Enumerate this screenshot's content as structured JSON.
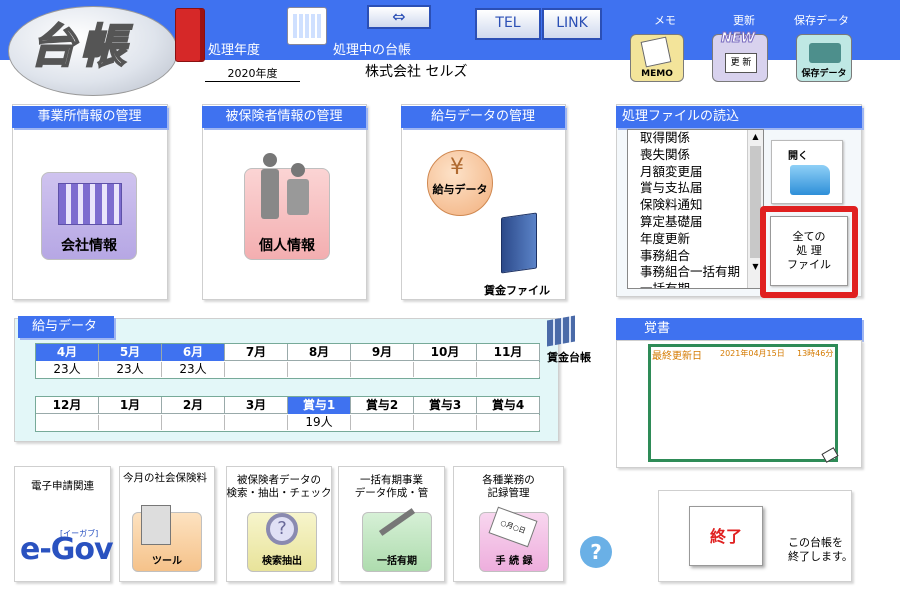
{
  "header": {
    "logo": "台帳",
    "fiscal_year_label": "処理年度",
    "fiscal_year_value": "2020年度",
    "ledger_label": "処理中の台帳",
    "ledger_value": "株式会社 セルズ",
    "tel_label": "TEL",
    "link_label": "LINK",
    "memo_top": "メモ",
    "memo_caption": "MEMO",
    "update_top": "更新",
    "update_new": "NEW",
    "update_caption": "更 新",
    "save_top": "保存データ",
    "save_caption": "保存データ"
  },
  "panels": {
    "office": {
      "title": "事業所情報の管理",
      "caption": "会社情報"
    },
    "insured": {
      "title": "被保険者情報の管理",
      "caption": "個人情報"
    },
    "salary": {
      "title": "給与データの管理",
      "data_caption": "給与データ",
      "file_caption": "賃金ファイル"
    }
  },
  "file_panel": {
    "title": "処理ファイルの読込",
    "items": [
      "取得関係",
      "喪失関係",
      "月額変更届",
      "賞与支払届",
      "保険料通知",
      "算定基礎届",
      "年度更新",
      "事務組合",
      "事務組合一括有期",
      "一括有期"
    ],
    "open_label": "開く",
    "all_files_label": "全ての\n処 理\nファイル"
  },
  "salary_data": {
    "title": "給与データ",
    "ledger_label": "賃金台帳",
    "row1": [
      {
        "month": "4月",
        "count": "23人",
        "active": true
      },
      {
        "month": "5月",
        "count": "23人",
        "active": true
      },
      {
        "month": "6月",
        "count": "23人",
        "active": true
      },
      {
        "month": "7月",
        "count": "",
        "active": false
      },
      {
        "month": "8月",
        "count": "",
        "active": false
      },
      {
        "month": "9月",
        "count": "",
        "active": false
      },
      {
        "month": "10月",
        "count": "",
        "active": false
      },
      {
        "month": "11月",
        "count": "",
        "active": false
      }
    ],
    "row2": [
      {
        "month": "12月",
        "count": "",
        "active": false
      },
      {
        "month": "1月",
        "count": "",
        "active": false
      },
      {
        "month": "2月",
        "count": "",
        "active": false
      },
      {
        "month": "3月",
        "count": "",
        "active": false
      },
      {
        "month": "賞与1",
        "count": "19人",
        "active": true
      },
      {
        "month": "賞与2",
        "count": "",
        "active": false
      },
      {
        "month": "賞与3",
        "count": "",
        "active": false
      },
      {
        "month": "賞与4",
        "count": "",
        "active": false
      }
    ]
  },
  "memo_panel": {
    "title": "覚書",
    "last_updated_label": "最終更新日",
    "last_updated_date": "2021年04月15日",
    "last_updated_time": "13時46分"
  },
  "tools": [
    {
      "label": "電子申請関連",
      "caption": "e-Gov",
      "sub": "[イーガブ]"
    },
    {
      "label": "今月の社会保険料",
      "caption": "ツール"
    },
    {
      "label": "被保険者データの\n検索・抽出・チェック",
      "caption": "検索抽出"
    },
    {
      "label": "一括有期事業\nデータ作成・管",
      "caption": "一括有期"
    },
    {
      "label": "各種業務の\n記録管理",
      "caption": "手 続 録",
      "badge": "○月○日"
    }
  ],
  "help_label": "?",
  "exit": {
    "label": "終了",
    "note": "この台帳を\n終了します。"
  },
  "colors": {
    "header_blue": "#3f72f0",
    "active_month": "#3f72f0",
    "exit_red": "#e02020",
    "memo_green": "#2e8b57"
  }
}
